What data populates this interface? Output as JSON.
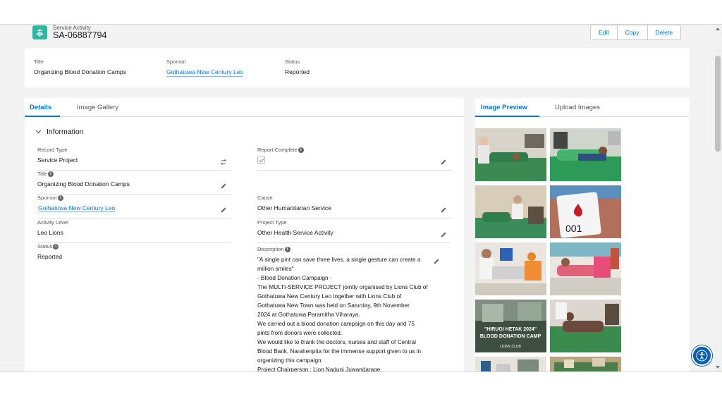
{
  "header": {
    "object_type": "Service Activity",
    "record_name": "SA-06887794",
    "icon": "service-activity-icon",
    "actions": [
      "Edit",
      "Copy",
      "Delete"
    ]
  },
  "highlights": [
    {
      "label": "Title",
      "value": "Organizing Blood Donation Camps"
    },
    {
      "label": "Sponsor",
      "value": "Gothatuwa New Century Leo"
    },
    {
      "label": "Status",
      "value": "Reported"
    }
  ],
  "details_tabs": [
    "Details",
    "Image Gallery"
  ],
  "section_title": "Information",
  "fields": {
    "record_type": {
      "label": "Record Type",
      "value": "Service Project"
    },
    "report_complete": {
      "label": "Report Complete",
      "checked": true
    },
    "title": {
      "label": "Title",
      "value": "Organizing Blood Donation Camps"
    },
    "sponsor": {
      "label": "Sponsor",
      "value": "Gothatuwa New Century Leo"
    },
    "cause": {
      "label": "Cause",
      "value": "Other Humanitarian Service"
    },
    "activity_level": {
      "label": "Activity Level",
      "value": "Leo Lions"
    },
    "project_type": {
      "label": "Project Type",
      "value": "Other Health Service Activity"
    },
    "status": {
      "label": "Status",
      "value": "Reported"
    }
  },
  "description": {
    "label": "Description",
    "lines": [
      "\"A single pint can save three lives, a single gesture can create a",
      "million smiles\"",
      "- Blood Donation Campaign -",
      "The MULTI-SERVICE PROJECT jointly organised by Lions Club of",
      "Gothatuwa New Century Leo together with Lions Club of",
      "Gothatuwa New Town was held on Saturday, 9th November",
      "2024 at Gothatuwa Paramitha Viharaya.",
      "We carried out a blood donation campaign on this day and 75",
      "pints from donors were collected.",
      "We would like to thank the doctors, nurses and staff of Central",
      "Blood Bank, Narahenpita for the immense support given to us in",
      "organizing this campaign.",
      "Project Chairperson : Lion Naduni Juwandarage"
    ]
  },
  "image_tabs": [
    "Image Preview",
    "Upload Images"
  ],
  "gallery": {
    "thumb_texts": {
      "bag_number": "001",
      "poster_title_1": "\"HIRUGI HETAK 2024\"",
      "poster_title_2": "BLOOD DONATION CAMP",
      "poster_club": "LIONS CLUB"
    }
  },
  "colors": {
    "accent": "#0176d3",
    "icon_bg": "#2fb5a1",
    "page_bg": "#f3f3f3",
    "a11y_button": "#0b5cab"
  }
}
